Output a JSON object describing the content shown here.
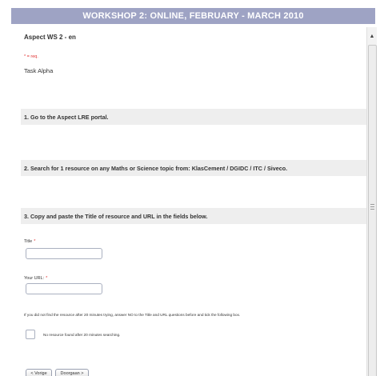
{
  "header": {
    "title": "WORKSHOP 2: ONLINE, FEBRUARY - MARCH 2010"
  },
  "survey": {
    "title": "Aspect WS 2 - en",
    "required_note": "* = req.",
    "task": "Task Alpha"
  },
  "questions": [
    {
      "label": "1. Go to the Aspect LRE portal."
    },
    {
      "label": "2. Search for 1 resource on any Maths or Science topic from: KlasCement / DGIDC / ITC / Siveco."
    },
    {
      "label": "3. Copy and paste the Title of resource and URL in the fields below."
    }
  ],
  "fields": {
    "title": {
      "label": "Title",
      "required_mark": "*",
      "value": ""
    },
    "url": {
      "label": "Your URL:",
      "required_mark": "*",
      "value": ""
    }
  },
  "info": "If you did not find the resource after 20 minutes trying, answer NO to the Title and URL questions before and tick the following box.",
  "checkbox": {
    "label": "No resource found after 20 minutes searching.",
    "checked": false
  },
  "buttons": {
    "prev": "< Vorige",
    "next": "Doorgaan >"
  },
  "scrollbar": {
    "up_arrow": "▲"
  },
  "colors": {
    "header_bg": "#9ea3c4",
    "question_band": "#eeeeee",
    "required": "#e03030"
  }
}
